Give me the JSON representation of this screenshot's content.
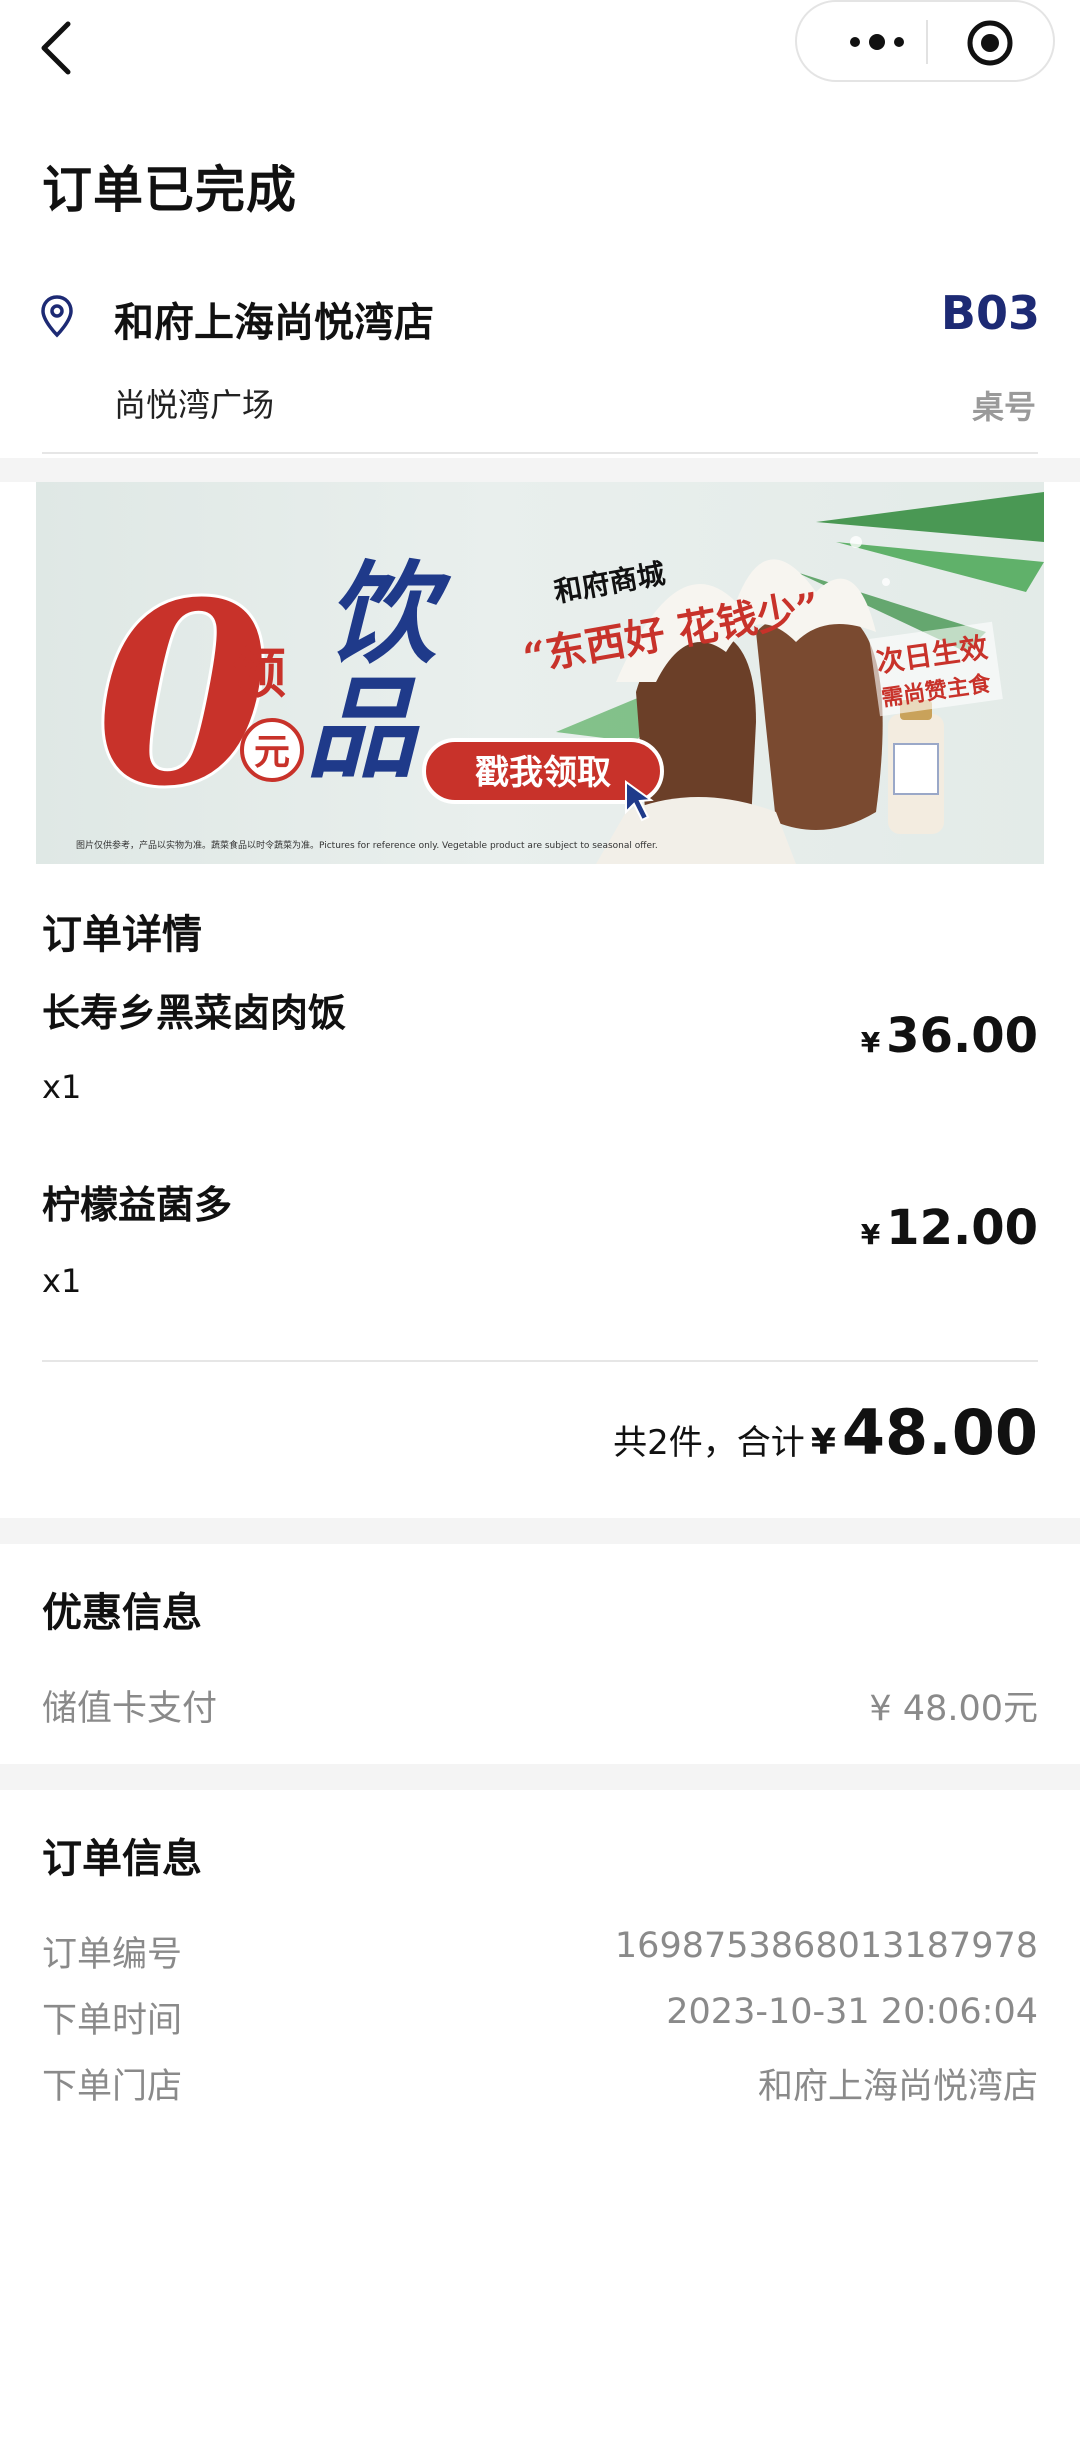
{
  "status": {
    "title": "订单已完成"
  },
  "store": {
    "name": "和府上海尚悦湾店",
    "area": "尚悦湾广场",
    "table_number": "B03",
    "table_label": "桌号"
  },
  "banner": {
    "brand": "和府商城",
    "slogan": "“东西好 花钱少”",
    "zero": "0",
    "ling": "领",
    "yuan": "元",
    "yin": "饮",
    "pin": "品",
    "cta": "戳我领取",
    "tag_line1": "次日生效",
    "tag_line2": "需尚赞主食",
    "fine_print": "图片仅供参考，产品以实物为准。蔬菜食品以时令蔬菜为准。Pictures for reference only. Vegetable product are subject to seasonal offer."
  },
  "order_details": {
    "title": "订单详情",
    "currency_symbol": "¥",
    "items": [
      {
        "name": "长寿乡黑菜卤肉饭",
        "qty": "x1",
        "price": "36.00"
      },
      {
        "name": "柠檬益菌多",
        "qty": "x1",
        "price": "12.00"
      }
    ],
    "summary_label": "共2件，合计",
    "total": "48.00"
  },
  "discount": {
    "title": "优惠信息",
    "rows": [
      {
        "label": "储值卡支付",
        "value": "¥ 48.00元"
      }
    ]
  },
  "order_info": {
    "title": "订单信息",
    "rows": [
      {
        "label": "订单编号",
        "value": "1698753868013187978"
      },
      {
        "label": "下单时间",
        "value": "2023-10-31 20:06:04"
      },
      {
        "label": "下单门店",
        "value": "和府上海尚悦湾店"
      }
    ]
  },
  "icons": {
    "back": "chevron-left-icon",
    "more": "more-dots-icon",
    "close": "target-circle-icon",
    "location": "location-pin-icon"
  },
  "colors": {
    "table_number": "#1d2a74",
    "banner_red": "#c8322a",
    "banner_blue": "#1f3a8a"
  }
}
